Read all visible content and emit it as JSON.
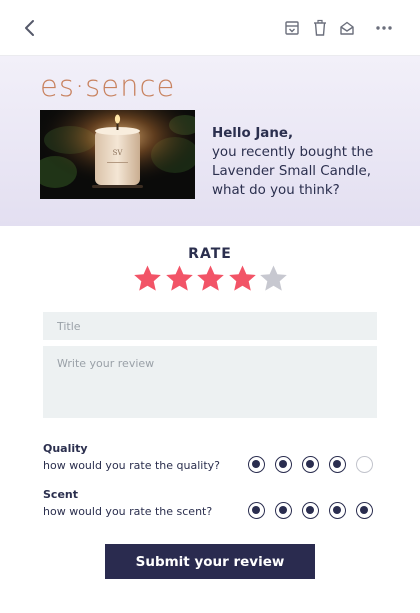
{
  "toolbar": {
    "back_icon": "chevron-left-icon",
    "actions": [
      "archive-icon",
      "trash-icon",
      "mail-open-icon",
      "more-icon"
    ]
  },
  "hero": {
    "logo": "es·sence",
    "photo": "candle-photo",
    "greeting_hello": "Hello Jane,",
    "greeting_lines": [
      "you recently bought the",
      "Lavender Small Candle,",
      "what do you think?"
    ]
  },
  "rating": {
    "label": "RATE",
    "value": 4,
    "max": 5,
    "active_color": "#f25467",
    "inactive_color": "#c7c8d0"
  },
  "form": {
    "title_placeholder": "Title",
    "review_placeholder": "Write your review"
  },
  "questions": [
    {
      "title": "Quality",
      "prompt": "how would you rate the quality?",
      "value": 4,
      "max": 5
    },
    {
      "title": "Scent",
      "prompt": "how would you rate the scent?",
      "value": 5,
      "max": 5
    }
  ],
  "submit_label": "Submit your review",
  "colors": {
    "logo": "#c8825f",
    "navy": "#2a2b4f",
    "input_bg": "#edf1f2"
  }
}
